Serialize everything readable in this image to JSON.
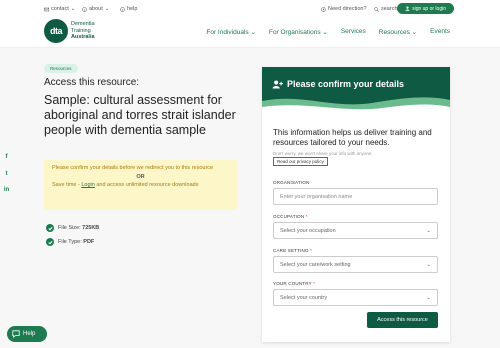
{
  "topbar": {
    "contact": "contact",
    "about": "about",
    "help": "help",
    "need_direction": "Need direction?",
    "search": "search",
    "signup": "sign up or login"
  },
  "logo": {
    "mark": "dta",
    "line1": "Dementia",
    "line2": "Training",
    "line3": "Australia"
  },
  "nav": {
    "items": [
      "For Individuals",
      "For Organisations",
      "Services",
      "Resources",
      "Events"
    ]
  },
  "left": {
    "pill": "Resources",
    "access_title": "Access this resource:",
    "sample_title": "Sample: cultural assessment for aboriginal and torres strait islander people with dementia sample",
    "notice_line1": "Please confirm your details before we redirect you to this resource",
    "notice_or": "OR",
    "notice_save_prefix": "Save time - ",
    "notice_login": "Login",
    "notice_save_suffix": " and access unlimited resource downloads",
    "file_size_label": "File Size: ",
    "file_size_value": "725KB",
    "file_type_label": "File Type: ",
    "file_type_value": "PDF"
  },
  "help_button": "Help",
  "form": {
    "title": "Please confirm your details",
    "intro": "This information helps us deliver training and resources tailored to your needs.",
    "small_note": "Don't worry, we won't share your info with anyone.",
    "privacy_button": "Read our privacy policy",
    "organisation_label": "ORGANISATION",
    "organisation_placeholder": "Enter your organisation name",
    "occupation_label": "OCCUPATION",
    "occupation_value": "Select your occupation",
    "care_label": "CARE SETTING",
    "care_value": "Select your care/work setting",
    "country_label": "YOUR COUNTRY",
    "country_value": "Select your country",
    "required_mark": "*",
    "submit": "Access this resource"
  },
  "colors": {
    "brand_green": "#1e7a4f",
    "dark_green": "#0f5a43",
    "notice_bg": "#fdf6c8"
  }
}
